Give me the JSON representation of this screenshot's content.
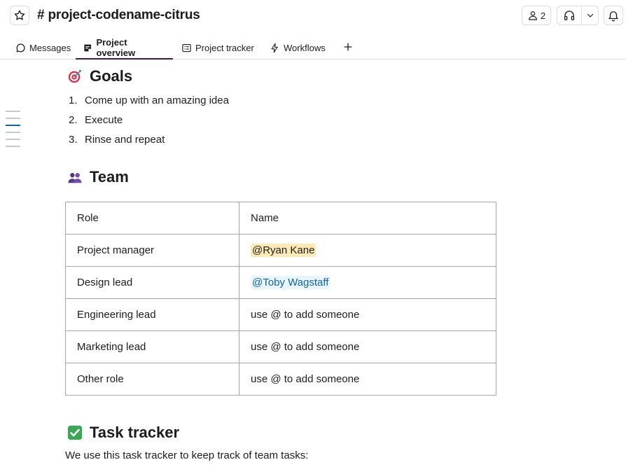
{
  "header": {
    "channel_hash": "#",
    "channel_name": "project-codename-citrus",
    "member_count": "2"
  },
  "tabs": [
    {
      "label": "Messages",
      "icon": "message-bubble-icon"
    },
    {
      "label": "Project overview",
      "icon": "canvas-icon"
    },
    {
      "label": "Project tracker",
      "icon": "list-icon"
    },
    {
      "label": "Workflows",
      "icon": "lightning-icon"
    }
  ],
  "active_tab": "Project overview",
  "goals": {
    "heading": "Goals",
    "icon": "target-emoji",
    "items": [
      {
        "num": "1.",
        "text": "Come up with an amazing idea"
      },
      {
        "num": "2.",
        "text": "Execute"
      },
      {
        "num": "3.",
        "text": "Rinse and repeat"
      }
    ]
  },
  "team": {
    "heading": "Team",
    "icon": "people-emoji",
    "columns": [
      "Role",
      "Name"
    ],
    "rows": [
      {
        "role": "Project manager",
        "name": "@Ryan Kane"
      },
      {
        "role": "Design lead",
        "name": "@Toby Wagstaff"
      },
      {
        "role": "Engineering lead",
        "name": "use @ to add someone"
      },
      {
        "role": "Marketing lead",
        "name": "use @ to add someone"
      },
      {
        "role": "Other role",
        "name": "use @ to add someone"
      }
    ]
  },
  "task_tracker": {
    "heading": "Task tracker",
    "icon": "check-mark-emoji",
    "description": "We use this task tracker to keep track of team tasks:"
  },
  "colors": {
    "accent": "#4a154b",
    "mention_highlight": "#fce9b4",
    "mention_link": "#1264a3",
    "check_green": "#3aa757"
  }
}
